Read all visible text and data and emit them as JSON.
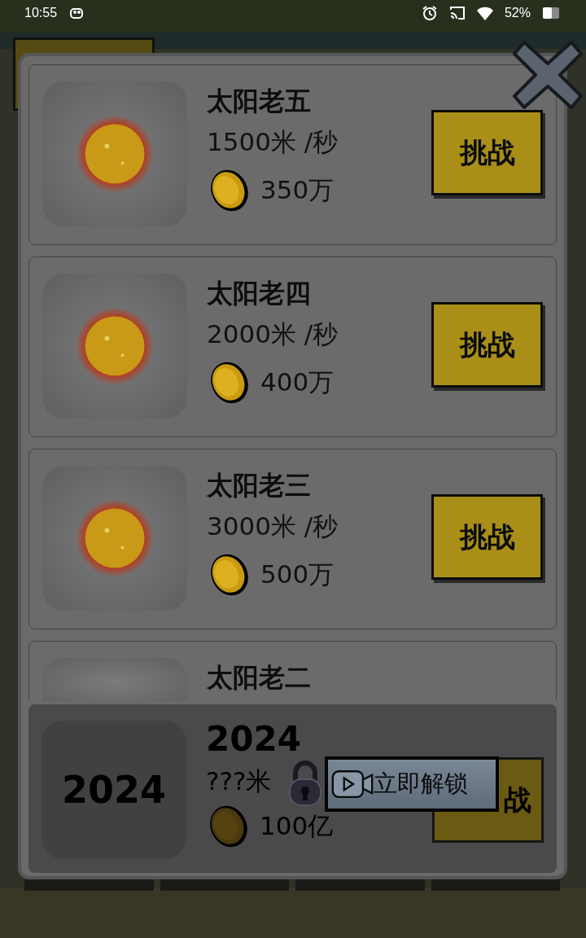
{
  "status_bar": {
    "time": "10:55",
    "battery": "52%"
  },
  "levels": [
    {
      "name": "太阳老五",
      "speed": "1500米 /秒",
      "cost": "350万",
      "button": "挑战"
    },
    {
      "name": "太阳老四",
      "speed": "2000米 /秒",
      "cost": "400万",
      "button": "挑战"
    },
    {
      "name": "太阳老三",
      "speed": "3000米 /秒",
      "cost": "500万",
      "button": "挑战"
    }
  ],
  "partial_level": {
    "name": "太阳老二"
  },
  "locked_level": {
    "icon_label": "2024",
    "name": "2024",
    "speed": "???米",
    "cost": "100亿",
    "button": "战",
    "unlock_button": "立即解锁"
  }
}
